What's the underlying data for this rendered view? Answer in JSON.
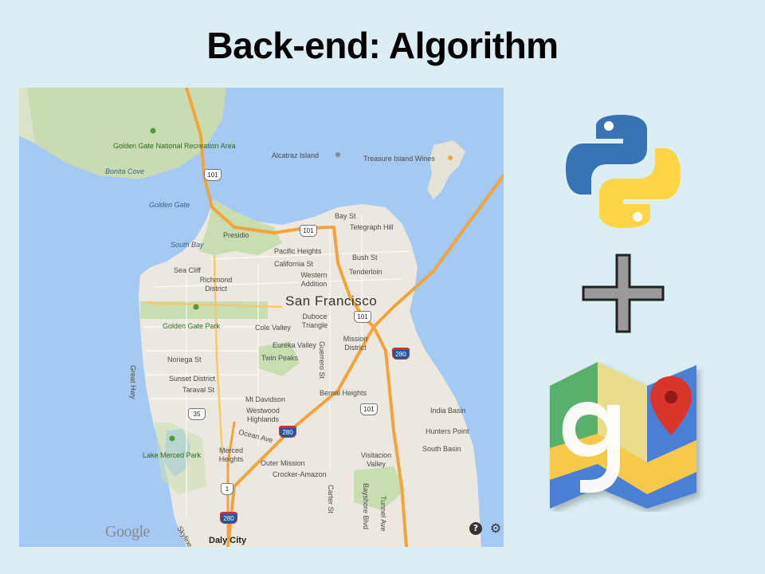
{
  "slide": {
    "title": "Back-end: Algorithm"
  },
  "map": {
    "city_label": "San Francisco",
    "labels": [
      "Golden Gate National Recreation Area",
      "Bonita Cove",
      "Golden Gate",
      "South Bay",
      "Presidio",
      "Sea Cliff",
      "Richmond District",
      "Golden Gate Park",
      "Noriega St",
      "Sunset District",
      "Taraval St",
      "Great Hwy",
      "Lake Merced Park",
      "Merced Heights",
      "Mt Davidson",
      "Westwood Highlands",
      "Ocean Ave",
      "Outer Mission",
      "Crocker-Amazon",
      "Daly City",
      "Alcatraz Island",
      "Treasure Island Wines",
      "Bay St",
      "Telegraph Hill",
      "Pacific Heights",
      "California St",
      "Bush St",
      "Tenderloin",
      "Western Addition",
      "Cole Valley",
      "Duboce Triangle",
      "Eureka Valley",
      "Twin Peaks",
      "Guerrero St",
      "Mission District",
      "Bernal Heights",
      "India Basin",
      "Hunters Point",
      "South Basin",
      "Visitacion Valley",
      "Carter St",
      "Bayshore Blvd",
      "Tunnel Ave",
      "Skyline"
    ],
    "route_shields": [
      "101",
      "101",
      "101",
      "101",
      "280",
      "280",
      "280",
      "35",
      "1"
    ],
    "attribution": "Google",
    "help_label": "?",
    "settings_label": "⚙"
  },
  "icons": {
    "python": "python-logo",
    "plus": "plus-icon",
    "google_maps": "google-maps-logo"
  }
}
